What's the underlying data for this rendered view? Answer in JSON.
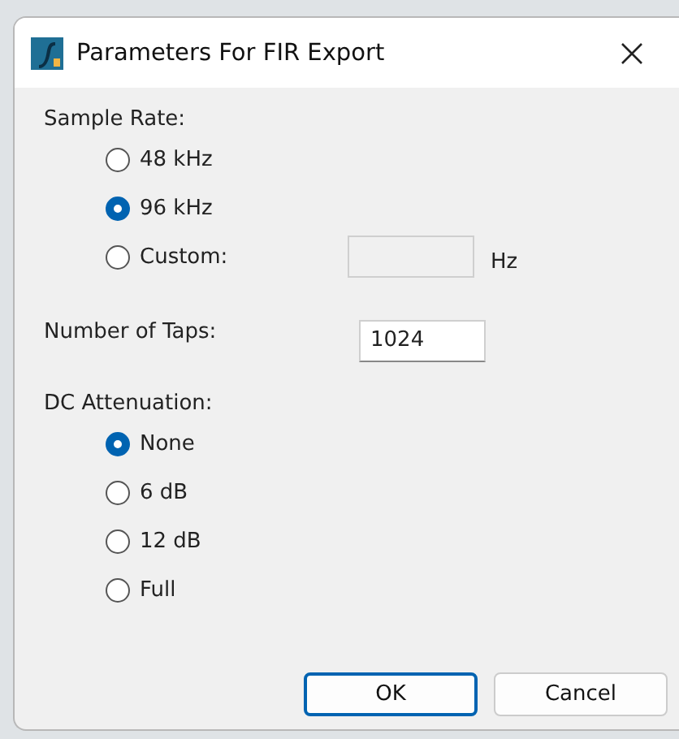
{
  "window": {
    "title": "Parameters For FIR Export"
  },
  "sample_rate": {
    "label": "Sample Rate:",
    "options": [
      {
        "label": "48 kHz",
        "selected": false
      },
      {
        "label": "96 kHz",
        "selected": true
      },
      {
        "label": "Custom:",
        "selected": false
      }
    ],
    "custom_field": {
      "disabled": true,
      "unit": "Hz"
    }
  },
  "taps": {
    "label": "Number of Taps:",
    "value": "1024"
  },
  "dc_attenuation": {
    "label": "DC Attenuation:",
    "options": [
      {
        "label": "None",
        "selected": true
      },
      {
        "label": "6 dB",
        "selected": false
      },
      {
        "label": "12 dB",
        "selected": false
      },
      {
        "label": "Full",
        "selected": false
      }
    ]
  },
  "buttons": [
    {
      "label": "OK",
      "default": true
    },
    {
      "label": "Cancel",
      "default": false
    }
  ]
}
